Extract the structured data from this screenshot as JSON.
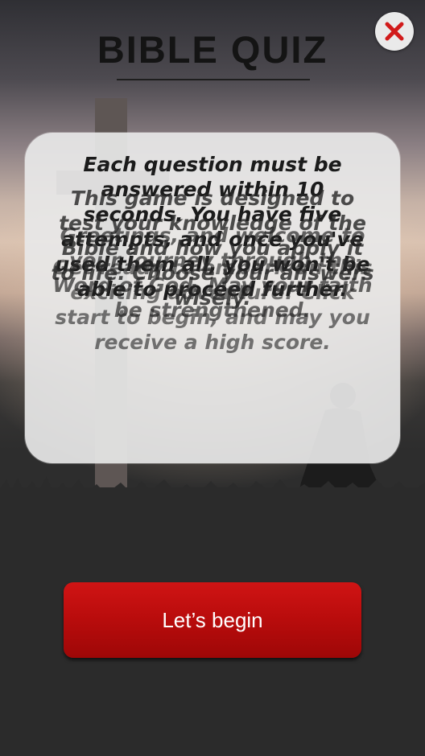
{
  "app": {
    "title": "BIBLE QUIZ"
  },
  "header": {
    "close_icon": "close-icon",
    "close_color": "#d11a1a"
  },
  "card": {
    "layer_a": "Each question must be answered within 10 seconds. You have five attempts, and once you've used them all, you won't be able to proceed further.",
    "layer_b": "This game is designed to test your knowledge of the Bible and how you apply it to life. Choose your answers wisely.",
    "layer_c": "Greetings, and welcome to your journey through the Word of God. May your faith be strengthened.",
    "layer_d": "Get ready to embark on this exciting adventure! Click start to begin, and may you receive a high score."
  },
  "actions": {
    "begin_label": "Let’s begin"
  },
  "colors": {
    "accent": "#b80c0c",
    "card_bg": "#e8e8e8",
    "title": "#141414"
  }
}
